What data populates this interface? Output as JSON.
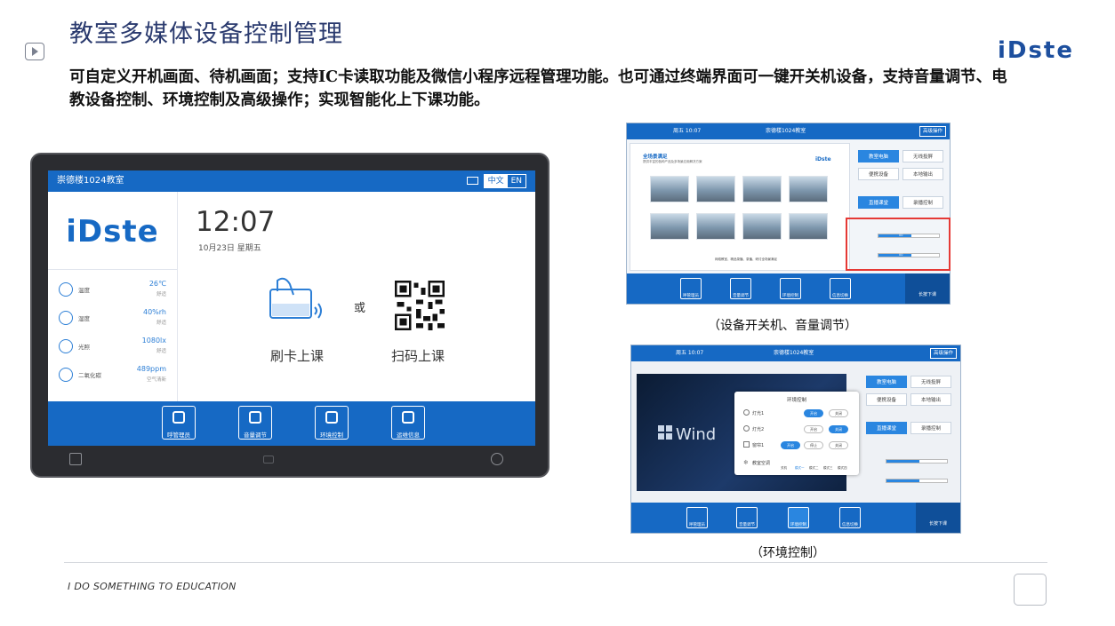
{
  "slide": {
    "title": "教室多媒体设备控制管理",
    "brand": "iDste",
    "description": "可自定义开机画面、待机画面；支持IC卡读取功能及微信小程序远程管理功能。也可通过终端界面可一键开关机设备，支持音量调节、电教设备控制、环境控制及高级操作；实现智能化上下课功能。",
    "footer": "I DO SOMETHING TO EDUCATION"
  },
  "tablet": {
    "room": "崇德楼1024教室",
    "lang_cn": "中文",
    "lang_en": "EN",
    "logo": "iDste",
    "time": "12:07",
    "date": "10月23日 星期五",
    "or": "或",
    "swipe_label": "刷卡上课",
    "scan_label": "扫码上课",
    "env": [
      {
        "name": "温度",
        "value": "26℃",
        "status": "舒适",
        "icon": "thermometer-icon"
      },
      {
        "name": "湿度",
        "value": "40%rh",
        "status": "舒适",
        "icon": "humidity-icon"
      },
      {
        "name": "光照",
        "value": "1080lx",
        "status": "舒适",
        "icon": "sun-icon"
      },
      {
        "name": "二氧化碳",
        "value": "489ppm",
        "status": "空气清新",
        "icon": "co2-icon"
      }
    ],
    "buttons": [
      "呼管理员",
      "音量调节",
      "环境控制",
      "运维信息"
    ]
  },
  "shot1": {
    "school_day": "周五 10:07",
    "room": "崇德楼1024教室",
    "advanced": "高级操作",
    "panel_title": "全场景满足",
    "panel_sub": "提供丰富的各种产品及多场景应用解决方案",
    "panel_brand": "iDste",
    "panel_caption": "网络教室、精品录播、录播、研讨全场景满足",
    "side_buttons": [
      "教室电脑",
      "无线投屏",
      "便携设备",
      "本地输出",
      "直播课堂",
      "录播控制"
    ],
    "volume_values": [
      "00",
      "00"
    ],
    "bottom_buttons": [
      "呼管理员",
      "音量调节",
      "环境控制",
      "信息切换"
    ],
    "power": "长按下课",
    "caption": "（设备开关机、音量调节）"
  },
  "shot2": {
    "school_day": "周五 10:07",
    "room": "崇德楼1024教室",
    "advanced": "高级操作",
    "windows_text": "Wind",
    "dialog_title": "环境控制",
    "rows": [
      {
        "label": "灯光1",
        "on": "开启",
        "off": "关闭"
      },
      {
        "label": "灯光2",
        "on": "开启",
        "off": "关闭"
      },
      {
        "label": "窗帘1",
        "on": "开启",
        "mid": "停止",
        "off": "关闭"
      }
    ],
    "ac_label": "教室空调",
    "ac_modes": [
      "关机",
      "模式一",
      "模式二",
      "模式三",
      "模式四"
    ],
    "side_buttons": [
      "教室电脑",
      "无线投屏",
      "便携设备",
      "本地输出",
      "直播课堂",
      "录播控制"
    ],
    "bottom_buttons": [
      "呼管理员",
      "音量调节",
      "环境控制",
      "信息切换"
    ],
    "power": "长按下课",
    "caption": "（环境控制）"
  }
}
